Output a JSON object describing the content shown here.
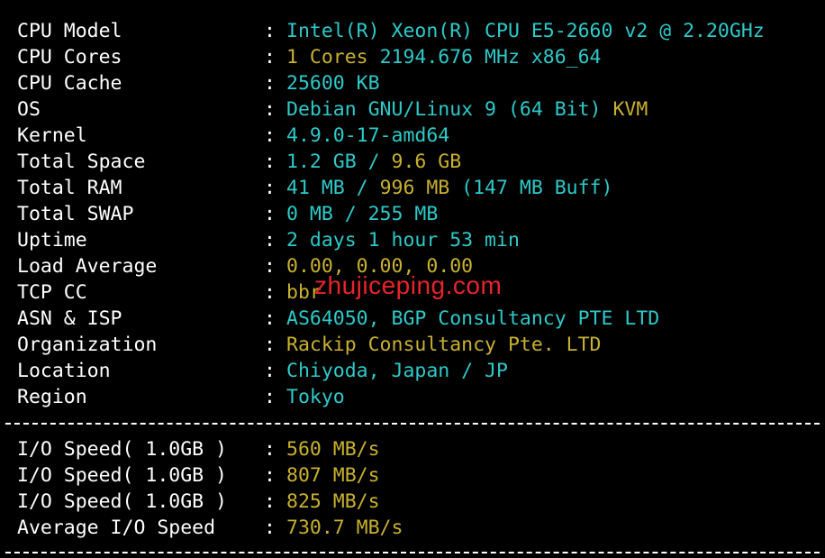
{
  "system_info": [
    {
      "label": "CPU Model",
      "value_parts": [
        {
          "text": "Intel(R) Xeon(R) CPU E5-2660 v2 @ 2.20GHz",
          "color": "cyan"
        }
      ]
    },
    {
      "label": "CPU Cores",
      "value_parts": [
        {
          "text": "1 Cores ",
          "color": "yellow"
        },
        {
          "text": "2194.676 MHz x86_64",
          "color": "cyan"
        }
      ]
    },
    {
      "label": "CPU Cache",
      "value_parts": [
        {
          "text": "25600 KB",
          "color": "cyan"
        }
      ]
    },
    {
      "label": "OS",
      "value_parts": [
        {
          "text": "Debian GNU/Linux 9 (64 Bit) ",
          "color": "cyan"
        },
        {
          "text": "KVM",
          "color": "yellow"
        }
      ]
    },
    {
      "label": "Kernel",
      "value_parts": [
        {
          "text": "4.9.0-17-amd64",
          "color": "cyan"
        }
      ]
    },
    {
      "label": "Total Space",
      "value_parts": [
        {
          "text": "1.2 GB / ",
          "color": "cyan"
        },
        {
          "text": "9.6 GB",
          "color": "yellow"
        }
      ]
    },
    {
      "label": "Total RAM",
      "value_parts": [
        {
          "text": "41 MB / ",
          "color": "cyan"
        },
        {
          "text": "996 MB ",
          "color": "yellow"
        },
        {
          "text": "(147 MB Buff)",
          "color": "cyan"
        }
      ]
    },
    {
      "label": "Total SWAP",
      "value_parts": [
        {
          "text": "0 MB / 255 MB",
          "color": "cyan"
        }
      ]
    },
    {
      "label": "Uptime",
      "value_parts": [
        {
          "text": "2 days 1 hour 53 min",
          "color": "cyan"
        }
      ]
    },
    {
      "label": "Load Average",
      "value_parts": [
        {
          "text": "0.00, 0.00, 0.00",
          "color": "yellow"
        }
      ]
    },
    {
      "label": "TCP CC",
      "value_parts": [
        {
          "text": "bbr",
          "color": "yellow"
        }
      ]
    },
    {
      "label": "ASN & ISP",
      "value_parts": [
        {
          "text": "AS64050, BGP Consultancy PTE LTD",
          "color": "cyan"
        }
      ]
    },
    {
      "label": "Organization",
      "value_parts": [
        {
          "text": "Rackip Consultancy Pte. LTD",
          "color": "yellow"
        }
      ]
    },
    {
      "label": "Location",
      "value_parts": [
        {
          "text": "Chiyoda, Japan / JP",
          "color": "cyan"
        }
      ]
    },
    {
      "label": "Region",
      "value_parts": [
        {
          "text": "Tokyo",
          "color": "cyan"
        }
      ]
    }
  ],
  "io_results": [
    {
      "label": "I/O Speed( 1.0GB )",
      "value_parts": [
        {
          "text": "560 MB/s",
          "color": "yellow"
        }
      ]
    },
    {
      "label": "I/O Speed( 1.0GB )",
      "value_parts": [
        {
          "text": "807 MB/s",
          "color": "yellow"
        }
      ]
    },
    {
      "label": "I/O Speed( 1.0GB )",
      "value_parts": [
        {
          "text": "825 MB/s",
          "color": "yellow"
        }
      ]
    },
    {
      "label": "Average I/O Speed",
      "value_parts": [
        {
          "text": "730.7 MB/s",
          "color": "yellow"
        }
      ]
    }
  ],
  "separator": ":",
  "watermark": "zhujiceping.com",
  "colors": {
    "background": "#000000",
    "label": "#ffffff",
    "cyan": "#2ec9c9",
    "yellow": "#c9b12e",
    "watermark": "#e8242b"
  }
}
